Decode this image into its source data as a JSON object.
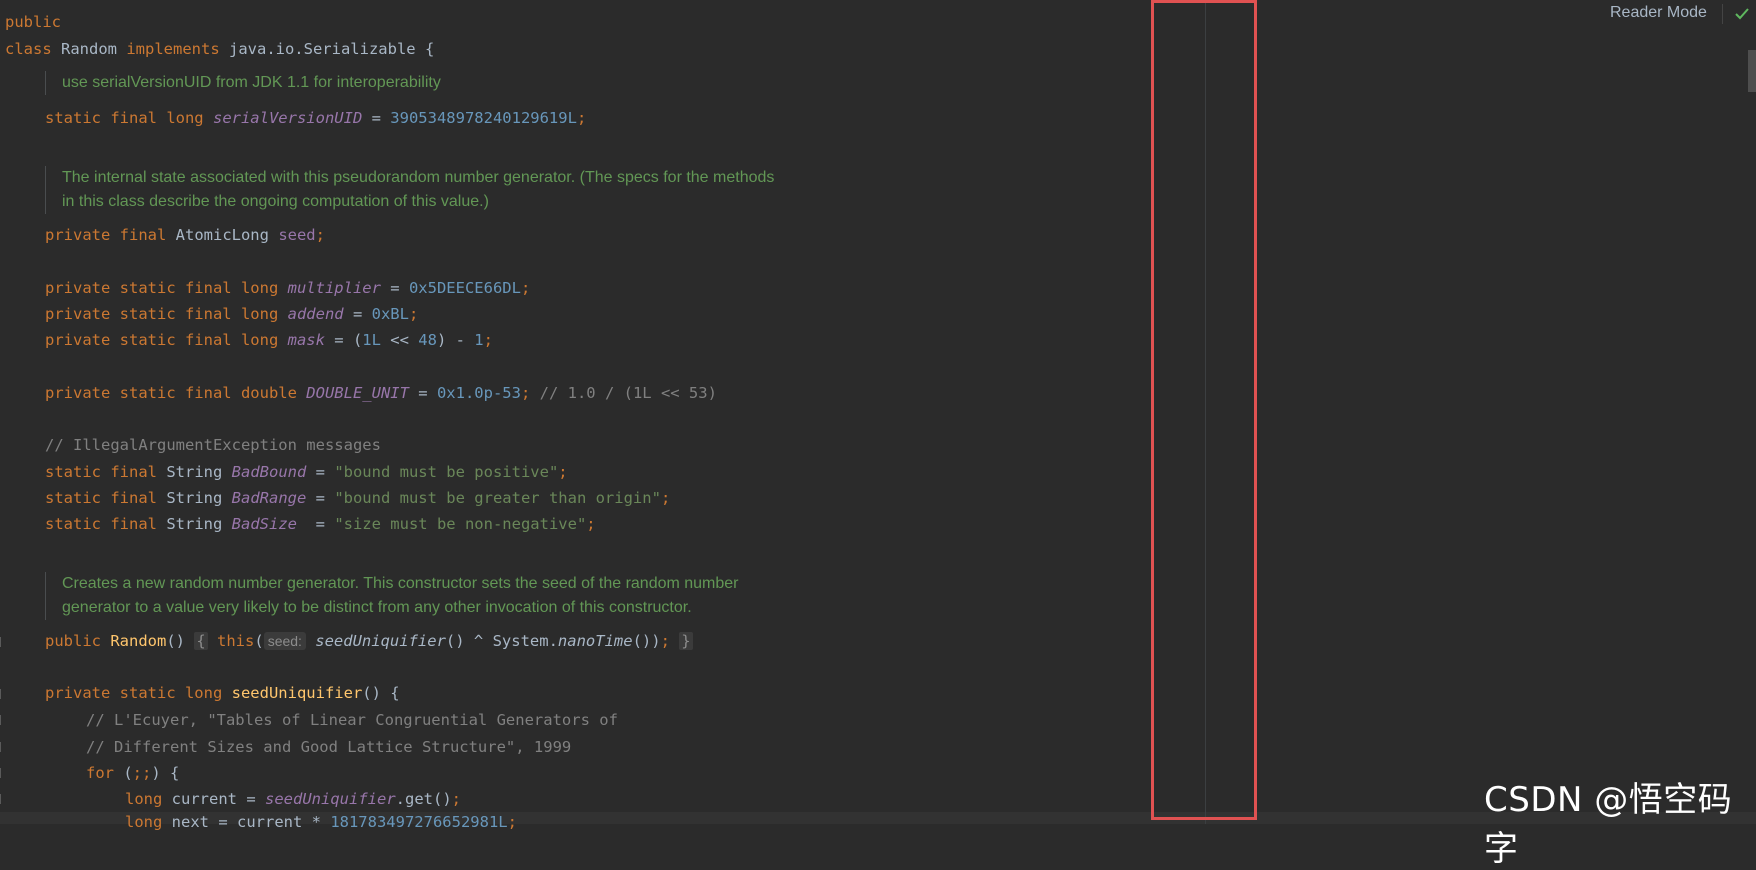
{
  "toolbar": {
    "reader_mode_label": "Reader Mode"
  },
  "watermark": "CSDN @悟空码字",
  "colors": {
    "highlight_box": "#e05252",
    "keyword": "#cc7832",
    "doc_comment": "#629755"
  },
  "code": {
    "l1": "public",
    "l2_kw1": "class",
    "l2_name": " Random ",
    "l2_kw2": "implements",
    "l2_rest": " java.io.Serializable {",
    "doc1": "use serialVersionUID from JDK 1.1 for interoperability",
    "l4_kw": "static final long ",
    "l4_fld": "serialVersionUID",
    "l4_eq": " = ",
    "l4_num": "3905348978240129619L",
    "l4_semi": ";",
    "doc2a": "The internal state associated with this pseudorandom number generator. (The specs for the methods",
    "doc2b": "in this class describe the ongoing computation of this value.)",
    "l6_kw": "private final ",
    "l6_type": "AtomicLong ",
    "l6_fld": "seed",
    "l6_semi": ";",
    "l7_kw": "private static final long ",
    "l7_fld": "multiplier",
    "l7_eq": " = ",
    "l7_num": "0x5DEECE66DL",
    "l7_semi": ";",
    "l8_kw": "private static final long ",
    "l8_fld": "addend",
    "l8_eq": " = ",
    "l8_num": "0xBL",
    "l8_semi": ";",
    "l9_kw": "private static final long ",
    "l9_fld": "mask",
    "l9_eq": " = (",
    "l9_num1": "1L",
    "l9_op": " << ",
    "l9_num2": "48",
    "l9_minus": ") - ",
    "l9_num3": "1",
    "l9_semi": ";",
    "l10_kw": "private static final double ",
    "l10_fld": "DOUBLE_UNIT",
    "l10_eq": " = ",
    "l10_num": "0x1.0p-53",
    "l10_semi": "; ",
    "l10_cmt": "// 1.0 / (1L << 53)",
    "l11_cmt": "// IllegalArgumentException messages",
    "l12_kw": "static final ",
    "l12_type": "String ",
    "l12_fld": "BadBound",
    "l12_eq": " = ",
    "l12_str": "\"bound must be positive\"",
    "l12_semi": ";",
    "l13_kw": "static final ",
    "l13_type": "String ",
    "l13_fld": "BadRange",
    "l13_eq": " = ",
    "l13_str": "\"bound must be greater than origin\"",
    "l13_semi": ";",
    "l14_kw": "static final ",
    "l14_type": "String ",
    "l14_fld": "BadSize",
    "l14_eq": "  = ",
    "l14_str": "\"size must be non-negative\"",
    "l14_semi": ";",
    "doc3a": "Creates a new random number generator. This constructor sets the seed of the random number",
    "doc3b": "generator to a value very likely to be distinct from any other invocation of this constructor.",
    "l15_kw": "public ",
    "l15_mth": "Random",
    "l15_paren": "() ",
    "l15_brace1": "{",
    "l15_this": " this",
    "l15_open": "(",
    "l15_hint": "seed:",
    "l15_call": " seedUniquifier",
    "l15_rest": "() ^ System.",
    "l15_nano": "nanoTime",
    "l15_end": "())",
    "l15_semi": "; ",
    "l15_brace2": "}",
    "l16_kw": "private static long ",
    "l16_mth": "seedUniquifier",
    "l16_rest": "() {",
    "l17_cmt": "// L'Ecuyer, \"Tables of Linear Congruential Generators of",
    "l18_cmt": "// Different Sizes and Good Lattice Structure\", 1999",
    "l19_kw": "for",
    "l19_rest1": " (",
    "l19_semi": ";;",
    "l19_rest2": ") {",
    "l20_kw": "long ",
    "l20_var": "current = ",
    "l20_fld": "seedUniquifier",
    "l20_rest": ".get()",
    "l20_semi": ";",
    "l21_kw": "long ",
    "l21_rest": "next = current * ",
    "l21_num": "181783497276652981L",
    "l21_semi": ";"
  }
}
